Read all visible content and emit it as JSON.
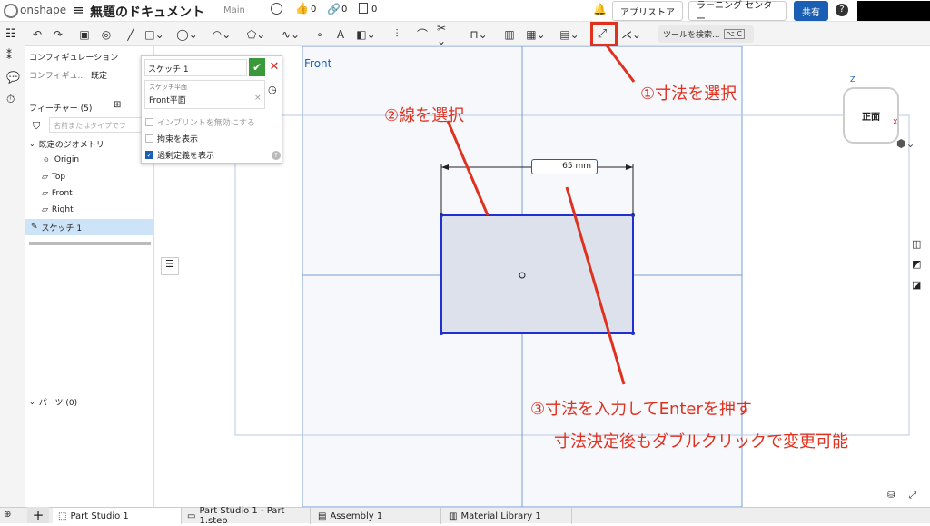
{
  "topbar": {
    "logo": "onshape",
    "title": "無題のドキュメント",
    "branch": "Main",
    "likes": "0",
    "links": "0",
    "copies": "0",
    "appstore": "アプリストア",
    "learning": "ラーニング センター",
    "share": "共有",
    "help": "?"
  },
  "toolbar": {
    "search": "ツールを検索...",
    "shortcut": "⌥ C"
  },
  "panel": {
    "config_title": "コンフィギュレーション",
    "config_label": "コンフィギュ...",
    "config_value": "既定",
    "features_title": "フィーチャー (5)",
    "filter_placeholder": "名前またはタイプでフ",
    "default_geometry": "既定のジオメトリ",
    "origin": "Origin",
    "top": "Top",
    "front": "Front",
    "right": "Right",
    "sketch": "スケッチ 1",
    "parts": "パーツ (0)"
  },
  "sketch_dialog": {
    "title": "スケッチ 1",
    "plane_label": "スケッチ平面",
    "plane_value": "Front平面",
    "opt1": "インプリントを無効にする",
    "opt2": "拘束を表示",
    "opt3": "過剰定義を表示"
  },
  "viewport": {
    "plane_label": "Front",
    "dimension": "65 mm",
    "cube_face": "正面",
    "axis_z": "Z",
    "axis_x": "X"
  },
  "annotations": {
    "step1": "①寸法を選択",
    "step2": "②線を選択",
    "step3": "③寸法を入力してEnterを押す",
    "note": "寸法決定後もダブルクリックで変更可能"
  },
  "bottom": {
    "add": "+",
    "tabs": [
      "Part Studio 1",
      "Part Studio 1 - Part 1.step",
      "Assembly 1",
      "Material Library 1"
    ]
  },
  "colors": {
    "accent": "#1a5fb4",
    "sketch_blue": "#1f2fd0",
    "annotation_red": "#e0301e",
    "confirm_green": "#3a9a3a"
  }
}
